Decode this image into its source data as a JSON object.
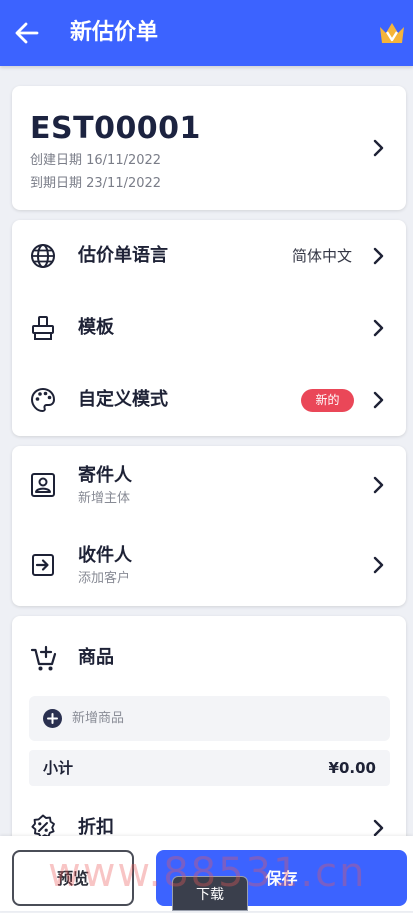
{
  "appbar": {
    "title": "新估价单",
    "back_icon": "arrow-left-icon",
    "crown_icon": "crown-icon",
    "background": "#3c63ff"
  },
  "estimate": {
    "number": "EST00001",
    "created": "创建日期 16/11/2022",
    "due": "到期日期 23/11/2022"
  },
  "settings": {
    "language_label": "估价单语言",
    "language_value": "简体中文",
    "template_label": "模板",
    "custom_label": "自定义模式",
    "custom_badge": "新的",
    "badge_color": "#ea4758"
  },
  "parties": {
    "sender_label": "寄件人",
    "sender_sub": "新增主体",
    "recipient_label": "收件人",
    "recipient_sub": "添加客户"
  },
  "items": {
    "header": "商品",
    "add_item": "新增商品",
    "subtotal_label": "小计",
    "subtotal_value": "¥0.00",
    "discount_label": "折扣"
  },
  "actions": {
    "preview": "预览",
    "save": "保存",
    "download": "下载"
  },
  "watermark": "www.88531.cn"
}
